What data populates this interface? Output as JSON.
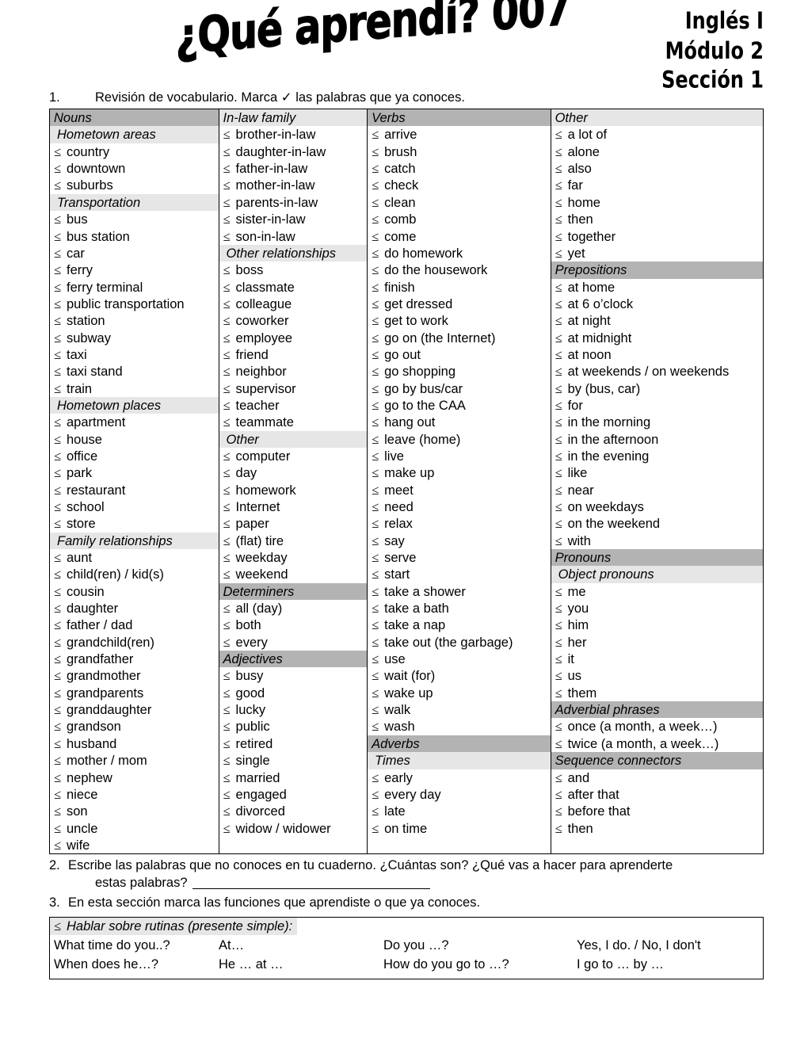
{
  "header": {
    "title": "¿Qué aprendí? 007",
    "course": [
      "Inglés I",
      "Módulo 2",
      "Sección 1"
    ]
  },
  "instructions": {
    "item1_num": "1.",
    "item1_text": "Revisión de vocabulario. Marca ✓ las palabras que ya conoces."
  },
  "checkbox_glyph": "≤",
  "table": {
    "columns": [
      {
        "header": "Nouns",
        "rows": [
          {
            "type": "sub",
            "text": "Hometown areas"
          },
          {
            "type": "item",
            "text": "country"
          },
          {
            "type": "item",
            "text": "downtown"
          },
          {
            "type": "item",
            "text": "suburbs"
          },
          {
            "type": "sub",
            "text": "Transportation"
          },
          {
            "type": "item",
            "text": "bus"
          },
          {
            "type": "item",
            "text": "bus station"
          },
          {
            "type": "item",
            "text": "car"
          },
          {
            "type": "item",
            "text": "ferry"
          },
          {
            "type": "item",
            "text": "ferry terminal"
          },
          {
            "type": "item",
            "text": "public transportation"
          },
          {
            "type": "item",
            "text": "station"
          },
          {
            "type": "item",
            "text": "subway"
          },
          {
            "type": "item",
            "text": "taxi"
          },
          {
            "type": "item",
            "text": "taxi stand"
          },
          {
            "type": "item",
            "text": "train"
          },
          {
            "type": "sub",
            "text": "Hometown places"
          },
          {
            "type": "item",
            "text": "apartment"
          },
          {
            "type": "item",
            "text": "house"
          },
          {
            "type": "item",
            "text": "office"
          },
          {
            "type": "item",
            "text": "park"
          },
          {
            "type": "item",
            "text": "restaurant"
          },
          {
            "type": "item",
            "text": "school"
          },
          {
            "type": "item",
            "text": "store"
          },
          {
            "type": "sub",
            "text": "Family relationships"
          },
          {
            "type": "item",
            "text": "aunt"
          },
          {
            "type": "item",
            "text": "child(ren) / kid(s)"
          },
          {
            "type": "item",
            "text": "cousin"
          },
          {
            "type": "item",
            "text": "daughter"
          },
          {
            "type": "item",
            "text": "father / dad"
          },
          {
            "type": "item",
            "text": "grandchild(ren)"
          },
          {
            "type": "item",
            "text": "grandfather"
          },
          {
            "type": "item",
            "text": "grandmother"
          },
          {
            "type": "item",
            "text": "grandparents"
          },
          {
            "type": "item",
            "text": "granddaughter"
          },
          {
            "type": "item",
            "text": "grandson"
          },
          {
            "type": "item",
            "text": "husband"
          },
          {
            "type": "item",
            "text": "mother / mom"
          },
          {
            "type": "item",
            "text": "nephew"
          },
          {
            "type": "item",
            "text": "niece"
          },
          {
            "type": "item",
            "text": "son"
          },
          {
            "type": "item",
            "text": "uncle"
          },
          {
            "type": "item",
            "text": "wife"
          }
        ]
      },
      {
        "header": "In-law family",
        "header_shade": "light",
        "rows": [
          {
            "type": "item",
            "text": "brother-in-law"
          },
          {
            "type": "item",
            "text": "daughter-in-law"
          },
          {
            "type": "item",
            "text": "father-in-law"
          },
          {
            "type": "item",
            "text": "mother-in-law"
          },
          {
            "type": "item",
            "text": "parents-in-law"
          },
          {
            "type": "item",
            "text": "sister-in-law"
          },
          {
            "type": "item",
            "text": "son-in-law"
          },
          {
            "type": "sub",
            "text": "Other relationships"
          },
          {
            "type": "item",
            "text": "boss"
          },
          {
            "type": "item",
            "text": "classmate"
          },
          {
            "type": "item",
            "text": "colleague"
          },
          {
            "type": "item",
            "text": "coworker"
          },
          {
            "type": "item",
            "text": "employee"
          },
          {
            "type": "item",
            "text": "friend"
          },
          {
            "type": "item",
            "text": "neighbor"
          },
          {
            "type": "item",
            "text": "supervisor"
          },
          {
            "type": "item",
            "text": "teacher"
          },
          {
            "type": "item",
            "text": "teammate"
          },
          {
            "type": "sub",
            "text": "Other"
          },
          {
            "type": "item",
            "text": "computer"
          },
          {
            "type": "item",
            "text": "day"
          },
          {
            "type": "item",
            "text": "homework"
          },
          {
            "type": "item",
            "text": "Internet"
          },
          {
            "type": "item",
            "text": "paper"
          },
          {
            "type": "item",
            "text": "(flat) tire"
          },
          {
            "type": "item",
            "text": "weekday"
          },
          {
            "type": "item",
            "text": "weekend"
          },
          {
            "type": "head",
            "text": "Determiners"
          },
          {
            "type": "item",
            "text": "all (day)"
          },
          {
            "type": "item",
            "text": "both"
          },
          {
            "type": "item",
            "text": "every"
          },
          {
            "type": "head",
            "text": "Adjectives"
          },
          {
            "type": "item",
            "text": "busy"
          },
          {
            "type": "item",
            "text": "good"
          },
          {
            "type": "item",
            "text": "lucky"
          },
          {
            "type": "item",
            "text": "public"
          },
          {
            "type": "item",
            "text": "retired"
          },
          {
            "type": "item",
            "text": "single"
          },
          {
            "type": "item",
            "text": "married"
          },
          {
            "type": "item",
            "text": "engaged"
          },
          {
            "type": "item",
            "text": "divorced"
          },
          {
            "type": "item",
            "text": "widow / widower"
          },
          {
            "type": "blank",
            "text": ""
          }
        ]
      },
      {
        "header": "Verbs",
        "rows": [
          {
            "type": "item",
            "text": "arrive"
          },
          {
            "type": "item",
            "text": "brush"
          },
          {
            "type": "item",
            "text": "catch"
          },
          {
            "type": "item",
            "text": "check"
          },
          {
            "type": "item",
            "text": "clean"
          },
          {
            "type": "item",
            "text": "comb"
          },
          {
            "type": "item",
            "text": "come"
          },
          {
            "type": "item",
            "text": "do homework"
          },
          {
            "type": "item",
            "text": "do the housework"
          },
          {
            "type": "item",
            "text": "finish"
          },
          {
            "type": "item",
            "text": "get dressed"
          },
          {
            "type": "item",
            "text": "get to work"
          },
          {
            "type": "item",
            "text": "go on (the Internet)"
          },
          {
            "type": "item",
            "text": "go out"
          },
          {
            "type": "item",
            "text": "go shopping"
          },
          {
            "type": "item",
            "text": "go by bus/car"
          },
          {
            "type": "item",
            "text": "go to the CAA"
          },
          {
            "type": "item",
            "text": "hang out"
          },
          {
            "type": "item",
            "text": "leave (home)"
          },
          {
            "type": "item",
            "text": "live"
          },
          {
            "type": "item",
            "text": "make up"
          },
          {
            "type": "item",
            "text": "meet"
          },
          {
            "type": "item",
            "text": "need"
          },
          {
            "type": "item",
            "text": "relax"
          },
          {
            "type": "item",
            "text": "say"
          },
          {
            "type": "item",
            "text": "serve"
          },
          {
            "type": "item",
            "text": "start"
          },
          {
            "type": "item",
            "text": "take a shower"
          },
          {
            "type": "item",
            "text": "take a bath"
          },
          {
            "type": "item",
            "text": "take a nap"
          },
          {
            "type": "item",
            "text": "take out (the garbage)"
          },
          {
            "type": "item",
            "text": "use"
          },
          {
            "type": "item",
            "text": "wait (for)"
          },
          {
            "type": "item",
            "text": "wake up"
          },
          {
            "type": "item",
            "text": "walk"
          },
          {
            "type": "item",
            "text": "wash"
          },
          {
            "type": "head",
            "text": "Adverbs"
          },
          {
            "type": "sub",
            "text": "Times"
          },
          {
            "type": "item",
            "text": "early"
          },
          {
            "type": "item",
            "text": "every day"
          },
          {
            "type": "item",
            "text": "late"
          },
          {
            "type": "item",
            "text": "on time"
          },
          {
            "type": "blank",
            "text": ""
          }
        ]
      },
      {
        "header": "Other",
        "header_shade": "light",
        "rows": [
          {
            "type": "item",
            "text": "a lot of"
          },
          {
            "type": "item",
            "text": "alone"
          },
          {
            "type": "item",
            "text": "also"
          },
          {
            "type": "item",
            "text": "far"
          },
          {
            "type": "item",
            "text": "home"
          },
          {
            "type": "item",
            "text": "then"
          },
          {
            "type": "item",
            "text": "together"
          },
          {
            "type": "item",
            "text": "yet"
          },
          {
            "type": "head",
            "text": "Prepositions"
          },
          {
            "type": "item",
            "text": "at home"
          },
          {
            "type": "item",
            "text": "at 6 o’clock"
          },
          {
            "type": "item",
            "text": "at night"
          },
          {
            "type": "item",
            "text": "at midnight"
          },
          {
            "type": "item",
            "text": "at noon"
          },
          {
            "type": "item",
            "text": "at weekends / on weekends"
          },
          {
            "type": "item",
            "text": "by (bus, car)"
          },
          {
            "type": "item",
            "text": "for"
          },
          {
            "type": "item",
            "text": "in the morning"
          },
          {
            "type": "item",
            "text": "in the afternoon"
          },
          {
            "type": "item",
            "text": "in the evening"
          },
          {
            "type": "item",
            "text": "like"
          },
          {
            "type": "item",
            "text": "near"
          },
          {
            "type": "item",
            "text": "on weekdays"
          },
          {
            "type": "item",
            "text": "on the weekend"
          },
          {
            "type": "item",
            "text": "with"
          },
          {
            "type": "head",
            "text": "Pronouns"
          },
          {
            "type": "sub",
            "text": "Object pronouns"
          },
          {
            "type": "item",
            "text": "me"
          },
          {
            "type": "item",
            "text": "you"
          },
          {
            "type": "item",
            "text": "him"
          },
          {
            "type": "item",
            "text": "her"
          },
          {
            "type": "item",
            "text": "it"
          },
          {
            "type": "item",
            "text": "us"
          },
          {
            "type": "item",
            "text": "them"
          },
          {
            "type": "head",
            "text": "Adverbial phrases"
          },
          {
            "type": "item",
            "text": "once (a month, a week…)"
          },
          {
            "type": "item",
            "text": "twice (a month, a week…)"
          },
          {
            "type": "head",
            "text": "Sequence connectors"
          },
          {
            "type": "item",
            "text": "and"
          },
          {
            "type": "item",
            "text": "after that"
          },
          {
            "type": "item",
            "text": "before that"
          },
          {
            "type": "item",
            "text": "then"
          },
          {
            "type": "blank",
            "text": ""
          }
        ]
      }
    ]
  },
  "tasks": [
    {
      "num": "2.",
      "line1": "Escribe las palabras que no conoces en tu cuaderno. ¿Cuántas son? ¿Qué vas a hacer para aprenderte",
      "line2": "estas palabras?"
    },
    {
      "num": "3.",
      "line1": "En esta sección marca las funciones que aprendiste o que ya conoces.",
      "line2": ""
    }
  ],
  "functions_box": {
    "heading": "Hablar sobre rutinas (presente simple):",
    "rows": [
      [
        "What time do you..?",
        "At…",
        "Do you …?",
        "Yes, I do. / No, I don't"
      ],
      [
        "When does he…?",
        "He … at …",
        "How do you go to …?",
        "I go to … by …"
      ]
    ]
  }
}
